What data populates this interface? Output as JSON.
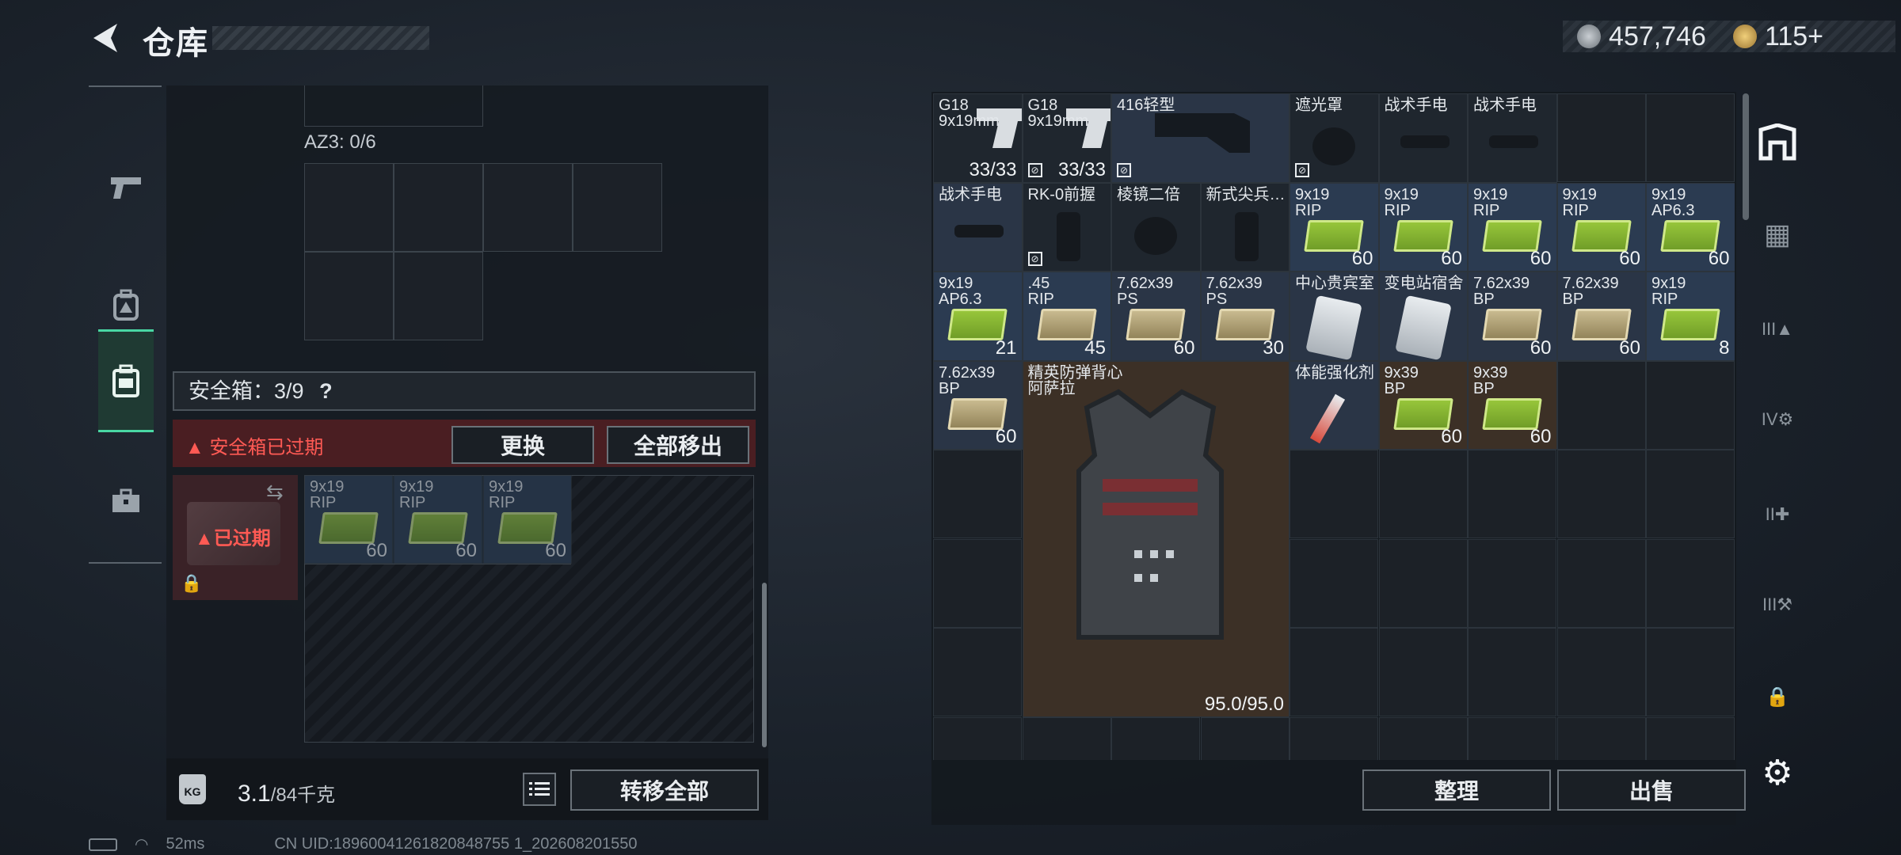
{
  "header": {
    "title": "仓库",
    "silver": "457,746",
    "gold": "115+"
  },
  "left_nav": {
    "items": [
      {
        "icon": "pistol-icon"
      },
      {
        "icon": "backpack-icon"
      },
      {
        "icon": "safe-case-icon",
        "active": true
      },
      {
        "icon": "toolbox-icon"
      }
    ]
  },
  "az3": {
    "label": "AZ3: 0/6"
  },
  "safe": {
    "label": "安全箱：3/9",
    "help": "?",
    "expired_notice": "安全箱已过期",
    "replace_button": "更换",
    "move_all_button": "全部移出",
    "case_status": "已过期",
    "items": [
      {
        "name": "9x19",
        "sub": "RIP",
        "qty": "60"
      },
      {
        "name": "9x19",
        "sub": "RIP",
        "qty": "60"
      },
      {
        "name": "9x19",
        "sub": "RIP",
        "qty": "60"
      }
    ]
  },
  "weight": {
    "current": "3.1",
    "max": "/84千克",
    "icon": "KG",
    "transfer_button": "转移全部"
  },
  "stash": {
    "items": [
      {
        "name": "G18",
        "sub": "9x19mm",
        "qty": "33/33",
        "col": 0,
        "row": 0,
        "color": "dark",
        "kind": "gun"
      },
      {
        "name": "G18",
        "sub": "9x19mm",
        "qty": "33/33",
        "col": 1,
        "row": 0,
        "color": "dark",
        "kind": "gun",
        "tag": true
      },
      {
        "name": "416轻型",
        "sub": "",
        "qty": "",
        "col": 2,
        "row": 0,
        "w": 2,
        "color": "blue",
        "kind": "stock",
        "tag": true
      },
      {
        "name": "遮光罩",
        "sub": "",
        "qty": "",
        "col": 4,
        "row": 0,
        "color": "dark",
        "kind": "scope",
        "tag": true
      },
      {
        "name": "战术手电",
        "sub": "",
        "qty": "",
        "col": 5,
        "row": 0,
        "color": "dark",
        "kind": "flash"
      },
      {
        "name": "战术手电",
        "sub": "",
        "qty": "",
        "col": 6,
        "row": 0,
        "color": "dark",
        "kind": "flash"
      },
      {
        "name": "战术手电",
        "sub": "",
        "qty": "",
        "col": 0,
        "row": 1,
        "color": "blue",
        "kind": "flash"
      },
      {
        "name": "RK-0前握",
        "sub": "",
        "qty": "",
        "col": 1,
        "row": 1,
        "color": "dark",
        "kind": "grip",
        "tag": true
      },
      {
        "name": "棱镜二倍",
        "sub": "",
        "qty": "",
        "col": 2,
        "row": 1,
        "color": "dark",
        "kind": "scope"
      },
      {
        "name": "新式尖兵…",
        "sub": "",
        "qty": "",
        "col": 3,
        "row": 1,
        "color": "dark",
        "kind": "grip"
      },
      {
        "name": "9x19",
        "sub": "RIP",
        "qty": "60",
        "col": 4,
        "row": 1,
        "color": "lblue",
        "kind": "ammo-green"
      },
      {
        "name": "9x19",
        "sub": "RIP",
        "qty": "60",
        "col": 5,
        "row": 1,
        "color": "lblue",
        "kind": "ammo-green"
      },
      {
        "name": "9x19",
        "sub": "RIP",
        "qty": "60",
        "col": 6,
        "row": 1,
        "color": "lblue",
        "kind": "ammo-green"
      },
      {
        "name": "9x19",
        "sub": "RIP",
        "qty": "60",
        "col": 7,
        "row": 1,
        "color": "lblue",
        "kind": "ammo-green"
      },
      {
        "name": "9x19",
        "sub": "AP6.3",
        "qty": "60",
        "col": 8,
        "row": 1,
        "color": "lblue",
        "kind": "ammo-green"
      },
      {
        "name": "9x19",
        "sub": "AP6.3",
        "qty": "21",
        "col": 0,
        "row": 2,
        "color": "lblue",
        "kind": "ammo-green"
      },
      {
        "name": ".45",
        "sub": "RIP",
        "qty": "45",
        "col": 1,
        "row": 2,
        "color": "lblue",
        "kind": "ammo-tan"
      },
      {
        "name": "7.62x39",
        "sub": "PS",
        "qty": "60",
        "col": 2,
        "row": 2,
        "color": "blue",
        "kind": "ammo-tan"
      },
      {
        "name": "7.62x39",
        "sub": "PS",
        "qty": "30",
        "col": 3,
        "row": 2,
        "color": "blue",
        "kind": "ammo-tan"
      },
      {
        "name": "中心贵宾室",
        "sub": "",
        "qty": "",
        "col": 4,
        "row": 2,
        "color": "blue",
        "kind": "card"
      },
      {
        "name": "变电站宿舍",
        "sub": "",
        "qty": "",
        "col": 5,
        "row": 2,
        "color": "blue",
        "kind": "card"
      },
      {
        "name": "7.62x39",
        "sub": "BP",
        "qty": "60",
        "col": 6,
        "row": 2,
        "color": "blue",
        "kind": "ammo-tan"
      },
      {
        "name": "7.62x39",
        "sub": "BP",
        "qty": "60",
        "col": 7,
        "row": 2,
        "color": "blue",
        "kind": "ammo-tan"
      },
      {
        "name": "9x19",
        "sub": "RIP",
        "qty": "8",
        "col": 8,
        "row": 2,
        "color": "lblue",
        "kind": "ammo-green"
      },
      {
        "name": "7.62x39",
        "sub": "BP",
        "qty": "60",
        "col": 0,
        "row": 3,
        "color": "blue",
        "kind": "ammo-tan"
      },
      {
        "name": "精英防弹背心",
        "sub": "阿萨拉",
        "qty": "95.0/95.0",
        "col": 1,
        "row": 3,
        "w": 3,
        "h": 4,
        "color": "brown",
        "kind": "vest"
      },
      {
        "name": "体能强化剂",
        "sub": "",
        "qty": "",
        "col": 4,
        "row": 3,
        "color": "blue",
        "kind": "syringe"
      },
      {
        "name": "9x39",
        "sub": "BP",
        "qty": "60",
        "col": 5,
        "row": 3,
        "color": "brown",
        "kind": "ammo-green"
      },
      {
        "name": "9x39",
        "sub": "BP",
        "qty": "60",
        "col": 6,
        "row": 3,
        "color": "brown",
        "kind": "ammo-green"
      }
    ],
    "sort_button": "整理",
    "sell_button": "出售"
  },
  "right_nav": {
    "items": [
      {
        "icon": "stash-icon",
        "active": true
      },
      {
        "icon": "stash-tab-1-icon"
      },
      {
        "icon": "stash-tab-3-icon",
        "label": "III"
      },
      {
        "icon": "stash-tab-4-icon",
        "label": "IV"
      },
      {
        "icon": "stash-tab-2-icon",
        "label": "II"
      },
      {
        "icon": "stash-tab-3b-icon",
        "label": "III"
      },
      {
        "icon": "lock-icon"
      },
      {
        "icon": "settings-icon"
      }
    ]
  },
  "status": {
    "ping": "52ms",
    "uid": "CN UID:18960041261820848755 1_202608201550"
  }
}
